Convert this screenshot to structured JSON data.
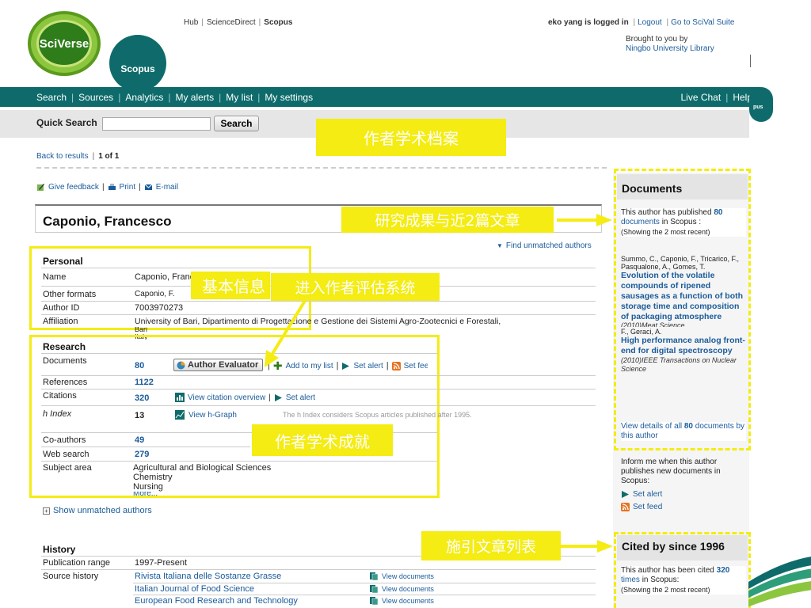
{
  "header": {
    "logo_main": "SciVerse",
    "logo_sub": "Scopus",
    "top_links": [
      "Hub",
      "ScienceDirect",
      "Scopus"
    ],
    "user_text": "eko yang is logged in",
    "logout": "Logout",
    "scival": "Go to SciVal Suite",
    "brought_line1": "Brought to you by",
    "brought_line2": "Ningbo University Library"
  },
  "nav": {
    "items": [
      "Search",
      "Sources",
      "Analytics",
      "My alerts",
      "My list",
      "My settings"
    ],
    "live_chat": "Live Chat",
    "help": "Help",
    "bubble": "pus"
  },
  "quick_search": {
    "label": "Quick Search",
    "value": "",
    "button": "Search"
  },
  "annotations": {
    "top": "作者学术档案",
    "docs": "研究成果与近2篇文章",
    "basic": "基本信息",
    "eval": "进入作者评估系统",
    "achieve": "作者学术成就",
    "cited": "施引文章列表"
  },
  "results_nav": {
    "back": "Back to results",
    "count": "1 of 1"
  },
  "actions": {
    "feedback": "Give feedback",
    "print": "Print",
    "email": "E-mail"
  },
  "author": {
    "name": "Caponio, Francesco",
    "find_unmatched": "Find unmatched authors"
  },
  "personal": {
    "title": "Personal",
    "rows": [
      {
        "label": "Name",
        "value": "Caponio, Francesco"
      },
      {
        "label": "Other formats",
        "value": "Caponio, F."
      },
      {
        "label": "Author ID",
        "value": "7003970273"
      },
      {
        "label": "Affiliation",
        "value": "University of Bari, Dipartimento di Progettazione e Gestione dei Sistemi Agro-Zootecnici e Forestali,"
      }
    ],
    "affil_city": "Bari",
    "affil_country": "Italy"
  },
  "research": {
    "title": "Research",
    "documents_label": "Documents",
    "documents_value": "80",
    "author_evaluator": "Author Evaluator",
    "add_to_list": "Add to my list",
    "set_alert": "Set alert",
    "set_feed": "Set feed",
    "references_label": "References",
    "references_value": "1122",
    "citations_label": "Citations",
    "citations_value": "320",
    "view_citation": "View citation overview",
    "citation_alert": "Set alert",
    "hindex_label": "h Index",
    "hindex_value": "13",
    "view_hgraph": "View h-Graph",
    "hindex_note": "The h Index considers Scopus articles published after 1995.",
    "coauthors_label": "Co-authors",
    "coauthors_value": "49",
    "websearch_label": "Web search",
    "websearch_value": "279",
    "subject_label": "Subject area",
    "subjects": [
      "Agricultural and Biological Sciences",
      "Chemistry",
      "Nursing"
    ],
    "more": "More..."
  },
  "show_unmatched": "Show unmatched authors",
  "history": {
    "title": "History",
    "pub_range_label": "Publication range",
    "pub_range_value": "1997-Present",
    "source_label": "Source history",
    "sources": [
      {
        "name": "Rivista Italiana delle Sostanze Grasse",
        "link": "View documents"
      },
      {
        "name": "Italian Journal of Food Science",
        "link": "View documents"
      },
      {
        "name": "European Food Research and Technology",
        "link": "View documents"
      }
    ]
  },
  "sidebar": {
    "docs_head": "Documents",
    "docs_pre": "This author has published",
    "docs_count": "80",
    "docs_link": "documents",
    "docs_post": "in Scopus :",
    "docs_showing": "(Showing the 2 most recent)",
    "doc1_authors": "Summo, C., Caponio, F., Tricarico, F., Pasqualone, A., Gomes, T.",
    "doc1_title": "Evolution of the volatile compounds of ripened sausages as a function of both storage time and composition of packaging atmosphere",
    "doc1_source": "(2010)Meat Science",
    "doc2_authors": "F., Geraci, A.",
    "doc2_title": "High performance analog front-end for digital spectroscopy",
    "doc2_source": "(2010)IEEE Transactions on Nuclear Science",
    "view_all_pre": "View details of all",
    "view_all_count": "80",
    "view_all_post": "documents by this author",
    "inform": "Inform me when this author publishes new documents in Scopus:",
    "set_alert": "Set alert",
    "set_feed": "Set feed",
    "cited_head": "Cited by since 1996",
    "cited_pre": "This author has been cited",
    "cited_count": "320",
    "cited_link": "times",
    "cited_post": "in Scopus:",
    "cited_showing": "(Showing the 2 most recent)"
  },
  "colors": {
    "teal": "#0f6b6b",
    "annotation_yellow": "#f4ec12",
    "link_blue": "#1a5b9a"
  }
}
